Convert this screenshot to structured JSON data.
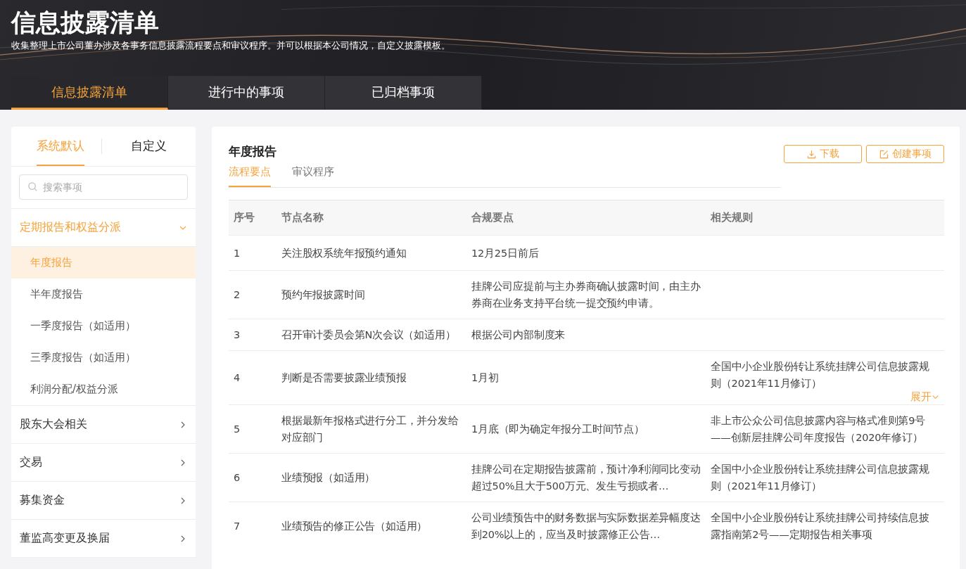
{
  "header": {
    "title": "信息披露清单",
    "subtitle": "收集整理上市公司董办涉及各事务信息披露流程要点和审议程序。并可以根据本公司情况，自定义披露模板。"
  },
  "tabs": [
    {
      "label": "信息披露清单",
      "selected": true
    },
    {
      "label": "进行中的事项",
      "selected": false
    },
    {
      "label": "已归档事项",
      "selected": false
    }
  ],
  "sidebar": {
    "tabs": [
      {
        "label": "系统默认",
        "selected": true
      },
      {
        "label": "自定义",
        "selected": false
      }
    ],
    "search": {
      "placeholder": "搜索事项"
    },
    "categories": [
      {
        "label": "定期报告和权益分派",
        "expanded": true,
        "children": [
          {
            "label": "年度报告",
            "selected": true
          },
          {
            "label": "半年度报告",
            "selected": false
          },
          {
            "label": "一季度报告（如适用）",
            "selected": false
          },
          {
            "label": "三季度报告（如适用）",
            "selected": false
          },
          {
            "label": "利润分配/权益分派",
            "selected": false
          }
        ]
      },
      {
        "label": "股东大会相关",
        "expanded": false
      },
      {
        "label": "交易",
        "expanded": false
      },
      {
        "label": "募集资金",
        "expanded": false
      },
      {
        "label": "董监高变更及换届",
        "expanded": false
      }
    ]
  },
  "main": {
    "title": "年度报告",
    "tabs": [
      {
        "label": "流程要点",
        "selected": true
      },
      {
        "label": "审议程序",
        "selected": false
      }
    ],
    "buttons": [
      {
        "label": "下载",
        "kind": "download"
      },
      {
        "label": "创建事项",
        "kind": "create"
      }
    ],
    "table": {
      "columns": [
        "序号",
        "节点名称",
        "合规要点",
        "相关规则"
      ],
      "rows": [
        {
          "cells": [
            "1",
            "关注股权系统年报预约通知",
            "12月25日前后",
            ""
          ]
        },
        {
          "cells": [
            "2",
            "预约年报披露时间",
            "挂牌公司应提前与主办券商确认披露时间，由主办券商在业务支持平台统一提交预约申请。",
            ""
          ]
        },
        {
          "cells": [
            "3",
            "召开审计委员会第N次会议（如适用）",
            "根据公司内部制度来",
            ""
          ]
        },
        {
          "cells": [
            "4",
            "判断是否需要披露业绩预报",
            "1月初",
            "全国中小企业股份转让系统挂牌公司信息披露规则（2021年11月修订）"
          ],
          "expand_link": "展开"
        },
        {
          "cells": [
            "5",
            "根据最新年报格式进行分工，并分发给对应部门",
            "1月底（即为确定年报分工时间节点）",
            "非上市公众公司信息披露内容与格式准则第9号——创新层挂牌公司年度报告（2020年修订）"
          ]
        },
        {
          "cells": [
            "6",
            "业绩预报（如适用）",
            "挂牌公司在定期报告披露前，预计净利润同比变动超过50%且大于500万元、发生亏损或者…",
            "全国中小企业股份转让系统挂牌公司信息披露规则（2021年11月修订）"
          ]
        },
        {
          "cells": [
            "7",
            "业绩预告的修正公告（如适用）",
            "公司业绩预告中的财务数据与实际数据差异幅度达到20%以上的，应当及时披露修正公告…",
            "全国中小企业股份转让系统挂牌公司持续信息披露指南第2号——定期报告相关事项"
          ]
        }
      ]
    }
  }
}
